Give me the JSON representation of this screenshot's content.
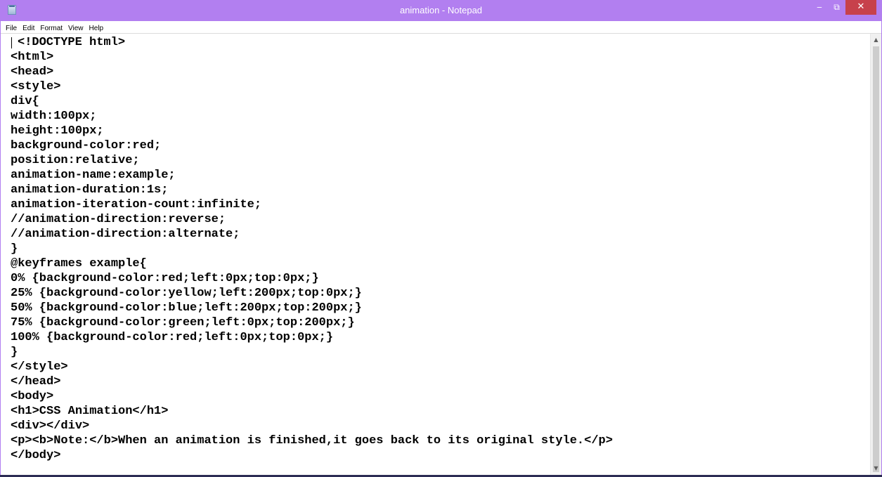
{
  "window": {
    "title": "animation - Notepad",
    "accent_color": "#b27ff0",
    "close_color": "#c7414b",
    "minimize_glyph": "‒",
    "maximize_glyph": "⧉",
    "close_glyph": "✕",
    "icon": "notepad-icon"
  },
  "menu": {
    "items": [
      {
        "label": "File"
      },
      {
        "label": "Edit"
      },
      {
        "label": "Format"
      },
      {
        "label": "View"
      },
      {
        "label": "Help"
      }
    ]
  },
  "editor": {
    "lines": [
      "<!DOCTYPE html>",
      "<html>",
      "<head>",
      "<style>",
      "div{",
      "width:100px;",
      "height:100px;",
      "background-color:red;",
      "position:relative;",
      "animation-name:example;",
      "animation-duration:1s;",
      "animation-iteration-count:infinite;",
      "//animation-direction:reverse;",
      "//animation-direction:alternate;",
      "}",
      "@keyframes example{",
      "0% {background-color:red;left:0px;top:0px;}",
      "25% {background-color:yellow;left:200px;top:0px;}",
      "50% {background-color:blue;left:200px;top:200px;}",
      "75% {background-color:green;left:0px;top:200px;}",
      "100% {background-color:red;left:0px;top:0px;}",
      "}",
      "</style>",
      "</head>",
      "<body>",
      "<h1>CSS Animation</h1>",
      "<div></div>",
      "<p><b>Note:</b>When an animation is finished,it goes back to its original style.</p>",
      "</body>"
    ]
  },
  "scrollbar": {
    "up_glyph": "▲",
    "down_glyph": "▼"
  }
}
